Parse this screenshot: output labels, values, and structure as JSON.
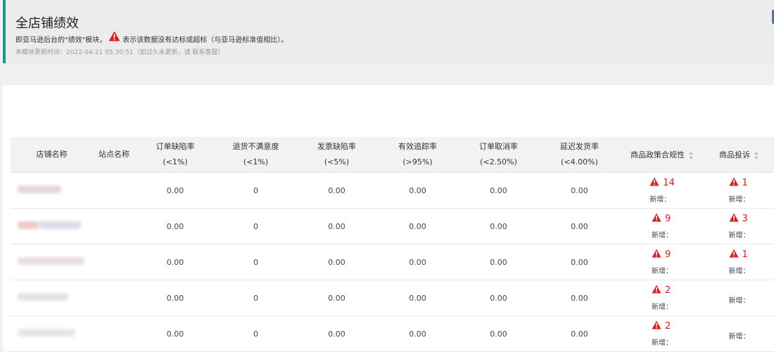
{
  "header": {
    "title": "全店铺绩效",
    "desc_before": "即亚马逊后台的\"绩效\"模块，",
    "desc_after": "表示该数据没有达标或超标（与亚马逊标准值相比）。",
    "update_label": "本模块更新时间：",
    "update_time": "2022-04-21 05:30:51",
    "update_note": "（如过久未更新，请 联系客服）"
  },
  "table": {
    "columns": [
      {
        "label": "店铺名称",
        "sub": ""
      },
      {
        "label": "站点名称",
        "sub": ""
      },
      {
        "label": "订单缺陷率",
        "sub": "(<1%)"
      },
      {
        "label": "退货不满意度",
        "sub": "(<1%)"
      },
      {
        "label": "发票缺陷率",
        "sub": "(<5%)"
      },
      {
        "label": "有效追踪率",
        "sub": "(>95%)"
      },
      {
        "label": "订单取消率",
        "sub": "(<2.50%)"
      },
      {
        "label": "延迟发货率",
        "sub": "(<4.00%)"
      },
      {
        "label": "商品政策合规性",
        "sub": ""
      },
      {
        "label": "商品投诉",
        "sub": ""
      }
    ],
    "new_label": "新增：",
    "rows": [
      {
        "odr": "0.00",
        "return": "0",
        "invoice": "0.00",
        "tracking": "0.00",
        "cancel": "0.00",
        "late": "0.00",
        "policy": "14",
        "complaint": "1"
      },
      {
        "odr": "0.00",
        "return": "0",
        "invoice": "0.00",
        "tracking": "0.00",
        "cancel": "0.00",
        "late": "0.00",
        "policy": "9",
        "complaint": "3"
      },
      {
        "odr": "0.00",
        "return": "0",
        "invoice": "0.00",
        "tracking": "0.00",
        "cancel": "0.00",
        "late": "0.00",
        "policy": "9",
        "complaint": "1"
      },
      {
        "odr": "0.00",
        "return": "0",
        "invoice": "0.00",
        "tracking": "0.00",
        "cancel": "0.00",
        "late": "0.00",
        "policy": "2",
        "complaint": ""
      },
      {
        "odr": "0.00",
        "return": "0",
        "invoice": "0.00",
        "tracking": "0.00",
        "cancel": "0.00",
        "late": "0.00",
        "policy": "2",
        "complaint": ""
      }
    ]
  },
  "colors": {
    "accent": "#1a9a80",
    "alert": "#e21b1b",
    "header_bg": "#ececec"
  },
  "icons": {
    "warning": "warning-triangle-icon",
    "sort": "sort-icon"
  }
}
